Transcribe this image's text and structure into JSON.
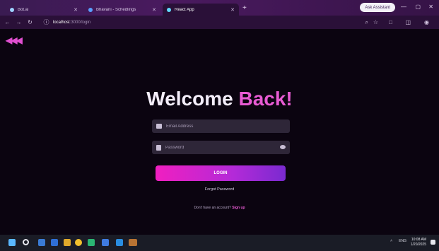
{
  "browser": {
    "tabs": [
      {
        "label": "Bot.ai"
      },
      {
        "label": "Bhavani - Schedlings"
      },
      {
        "label": "React App"
      }
    ],
    "new_tab": "+",
    "ai_button": "Ask Assistant",
    "url_host": "localhost",
    "url_path": ":3000/login"
  },
  "page": {
    "back_arrows": "◀◀◀",
    "title_main": "Welcome ",
    "title_accent": "Back!",
    "email_placeholder": "Email Address",
    "password_placeholder": "Password",
    "login_label": "LOGIN",
    "forgot_label": "Forgot Password",
    "signup_prompt": "Don't have an account? ",
    "signup_link": "Sign up"
  },
  "taskbar": {
    "tray_text": "ENG",
    "time": "10:08 AM",
    "date": "1/20/2025"
  },
  "colors": {
    "accent": "#e85bd3",
    "background": "#0b0410",
    "button_gradient_start": "#f01fc0",
    "button_gradient_end": "#7a2ad0"
  }
}
